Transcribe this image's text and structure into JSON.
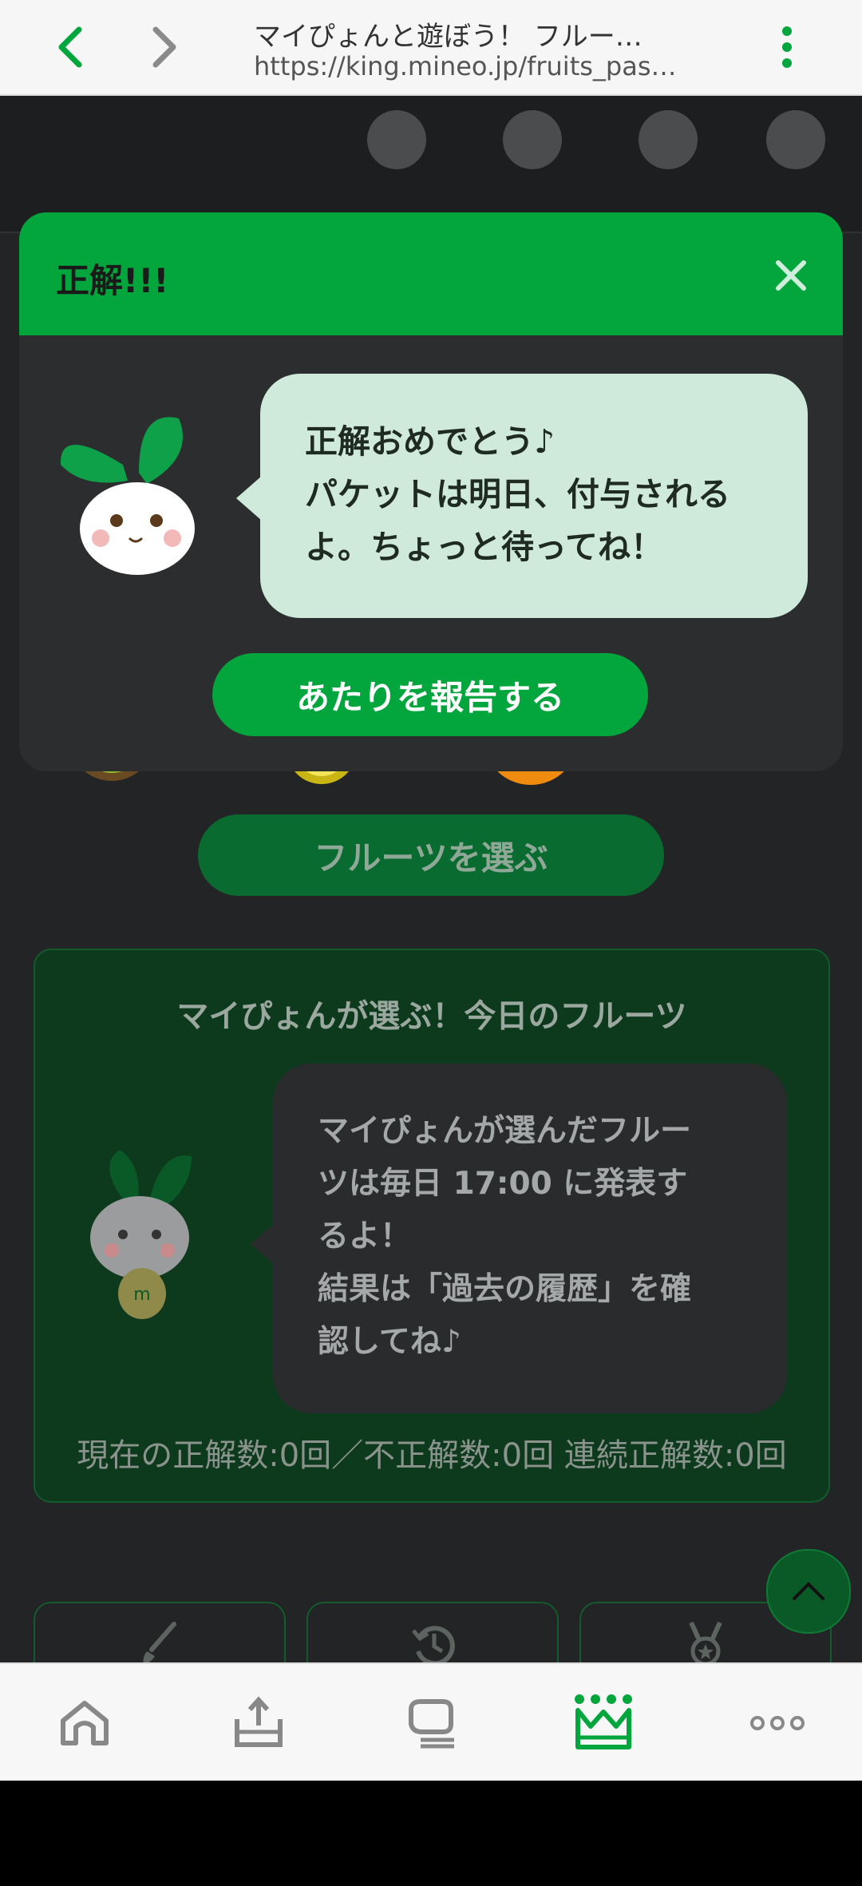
{
  "browser": {
    "page_title": "マイぴょんと遊ぼう！ フルー…",
    "url": "https://king.mineo.jp/fruits_pas…"
  },
  "modal": {
    "title": "正解!!!",
    "bubble_text": "正解おめでとう♪\nパケットは明日、付与される\nよ。ちょっと待ってね！",
    "report_button": "あたりを報告する"
  },
  "fruits": [
    "kiwi-icon",
    "lemon-icon",
    "orange-icon",
    "strawberry-icon"
  ],
  "choose_button": "フルーツを選ぶ",
  "today": {
    "title": "マイぴょんが選ぶ！今日のフルーツ",
    "bubble_text": "マイぴょんが選んだフルー\nツは毎日 17:00 に発表す\nるよ！\n結果は「過去の履歴」を確\n認してね♪",
    "stats": "現在の正解数:0回／不正解数:0回 連続正解数:0回"
  },
  "menu_icons": [
    "brush-icon",
    "history-icon",
    "medal-icon"
  ],
  "bottom_nav": [
    "home-icon",
    "upload-icon",
    "chat-icon",
    "crown-icon",
    "more-icon"
  ],
  "colors": {
    "accent": "#03a53d",
    "dark_green": "#0a6b30",
    "card_bg": "#0d3a1d",
    "bubble_light": "#cfeadb"
  }
}
